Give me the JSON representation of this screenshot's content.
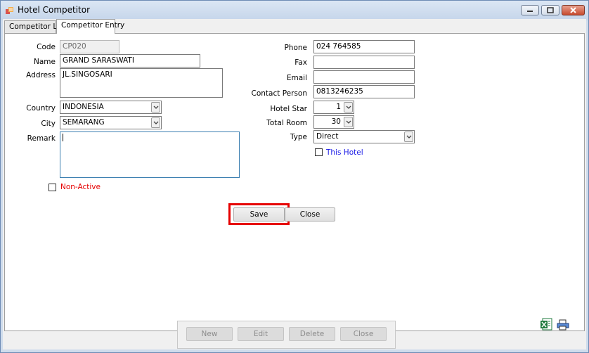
{
  "window": {
    "title": "Hotel Competitor"
  },
  "tabs": [
    {
      "label": "Competitor List",
      "active": false
    },
    {
      "label": "Competitor Entry",
      "active": true
    }
  ],
  "form": {
    "code": {
      "label": "Code",
      "value": "CP020"
    },
    "name": {
      "label": "Name",
      "value": "GRAND SARASWATI"
    },
    "address": {
      "label": "Address",
      "value": "JL.SINGOSARI"
    },
    "country": {
      "label": "Country",
      "value": "INDONESIA"
    },
    "city": {
      "label": "City",
      "value": "SEMARANG"
    },
    "remark": {
      "label": "Remark",
      "value": ""
    },
    "non_active": {
      "label": "Non-Active",
      "checked": false
    },
    "phone": {
      "label": "Phone",
      "value": "024 764585"
    },
    "fax": {
      "label": "Fax",
      "value": ""
    },
    "email": {
      "label": "Email",
      "value": ""
    },
    "contact_person": {
      "label": "Contact Person",
      "value": "0813246235"
    },
    "hotel_star": {
      "label": "Hotel Star",
      "value": "1"
    },
    "total_room": {
      "label": "Total Room",
      "value": "30"
    },
    "type": {
      "label": "Type",
      "value": "Direct"
    },
    "this_hotel": {
      "label": "This Hotel",
      "checked": false
    }
  },
  "actions": {
    "save": "Save",
    "close": "Close"
  },
  "toolbar": {
    "new": "New",
    "edit": "Edit",
    "delete": "Delete",
    "close": "Close"
  },
  "icons": {
    "excel": "excel-export-icon",
    "print": "print-icon"
  },
  "colors": {
    "red_label": "#e60000",
    "blue_label": "#1a1ae6",
    "highlight": "#e60000"
  }
}
